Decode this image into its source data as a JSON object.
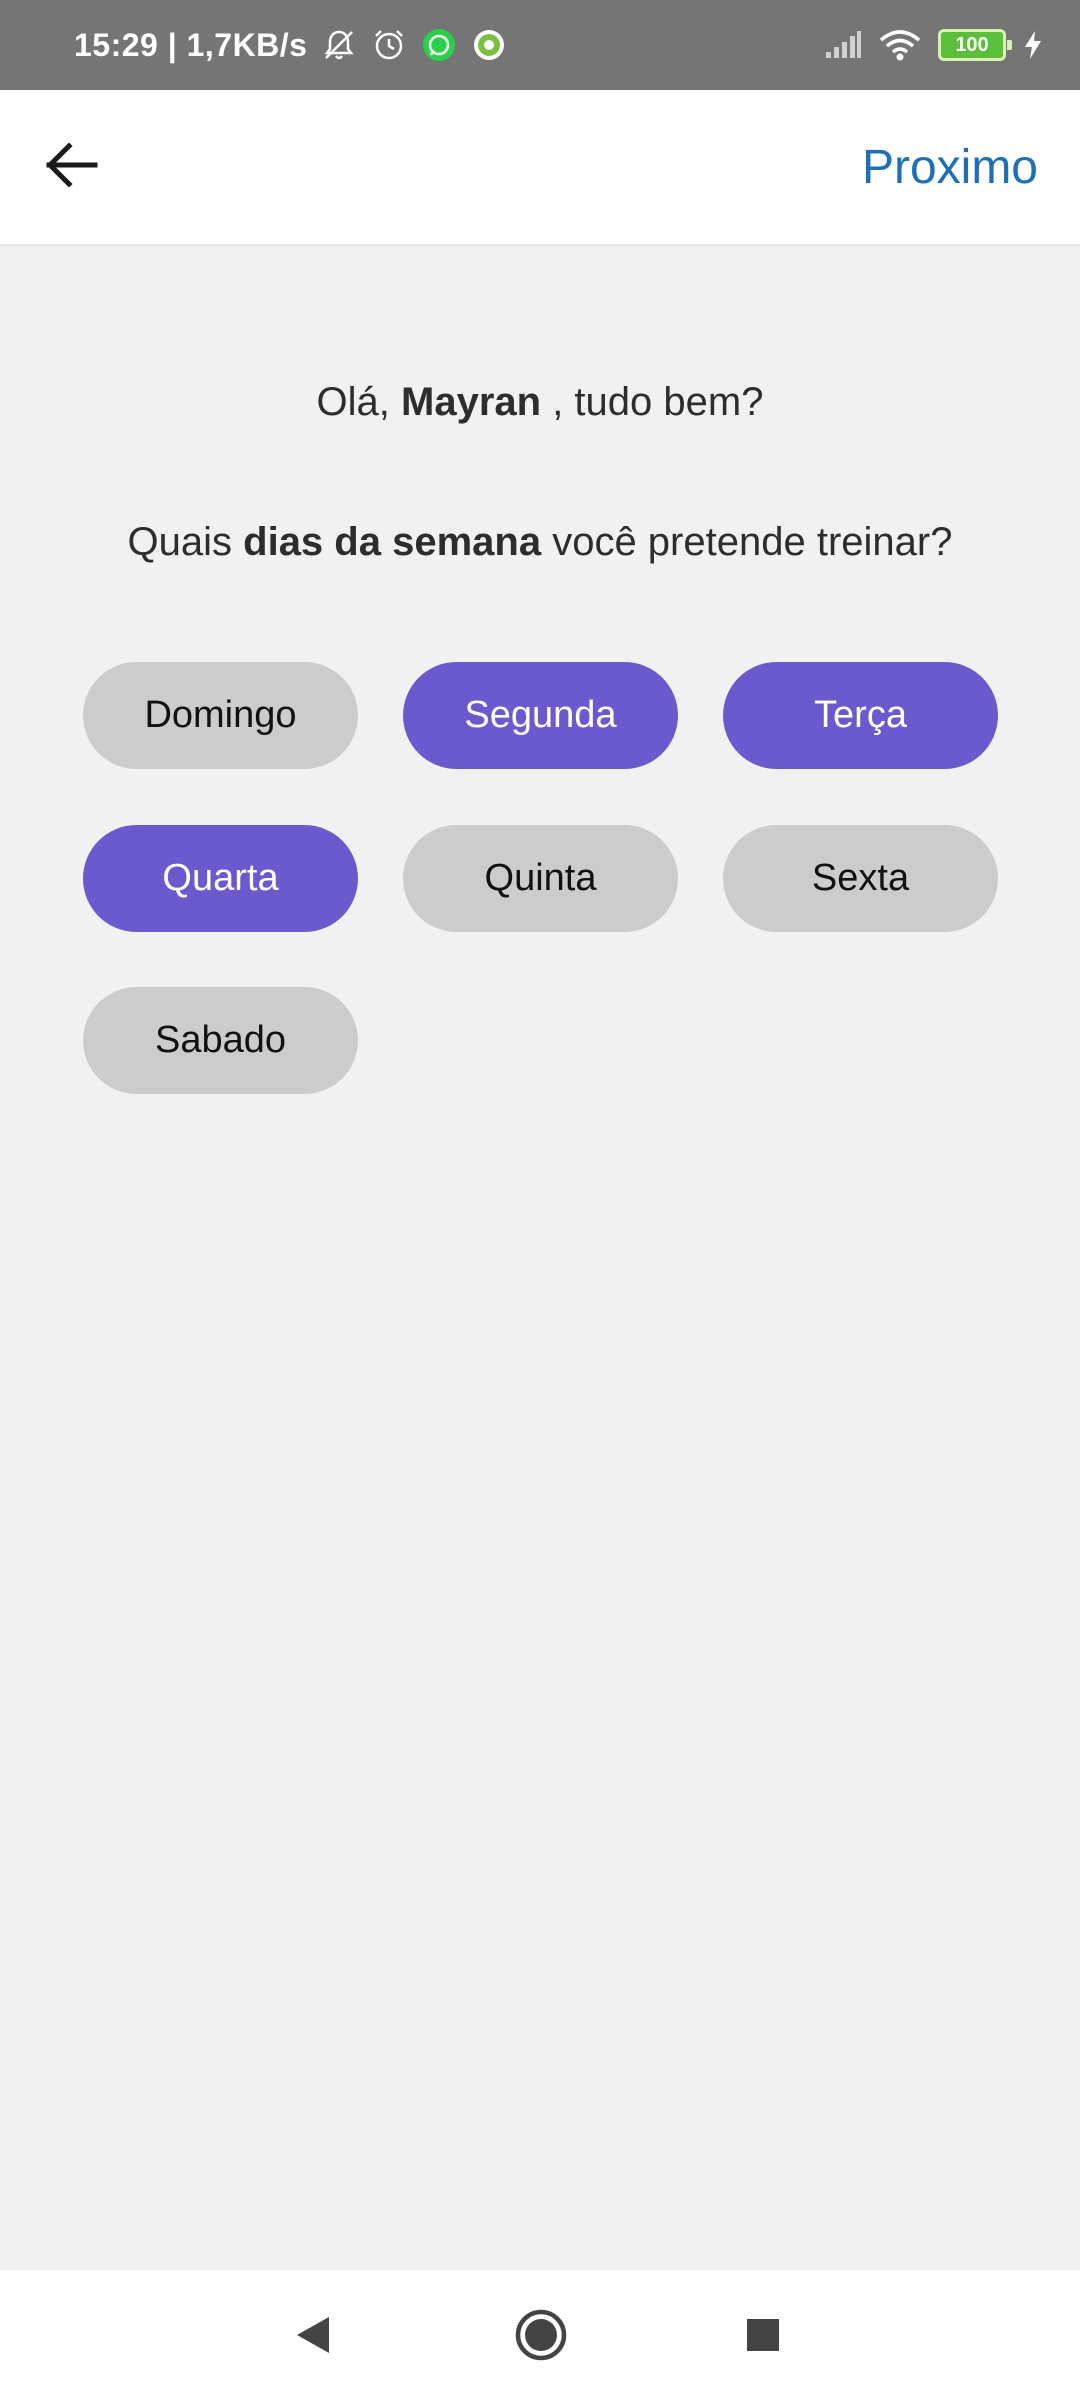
{
  "status_bar": {
    "time_and_speed": "15:29 | 1,7KB/s",
    "battery_level": "100",
    "icons": [
      "mute-icon",
      "alarm-icon",
      "whatsapp-icon",
      "app-notification-icon",
      "signal-icon",
      "wifi-icon",
      "battery-icon",
      "charging-icon"
    ]
  },
  "app_bar": {
    "next_label": "Proximo",
    "accent_color": "#1f6fb8"
  },
  "greeting": {
    "prefix": "Olá,",
    "name": "Mayran",
    "suffix": ", tudo bem?"
  },
  "question": {
    "prefix": "Quais",
    "emphasis": "dias da semana",
    "suffix": "você pretende treinar?"
  },
  "days": [
    {
      "label": "Domingo",
      "selected": false
    },
    {
      "label": "Segunda",
      "selected": true
    },
    {
      "label": "Terça",
      "selected": true
    },
    {
      "label": "Quarta",
      "selected": true
    },
    {
      "label": "Quinta",
      "selected": false
    },
    {
      "label": "Sexta",
      "selected": false
    },
    {
      "label": "Sabado",
      "selected": false
    }
  ],
  "colors": {
    "chip_selected": "#6a5acd",
    "chip_unselected": "#cccccc",
    "background": "#f1f1f2"
  }
}
